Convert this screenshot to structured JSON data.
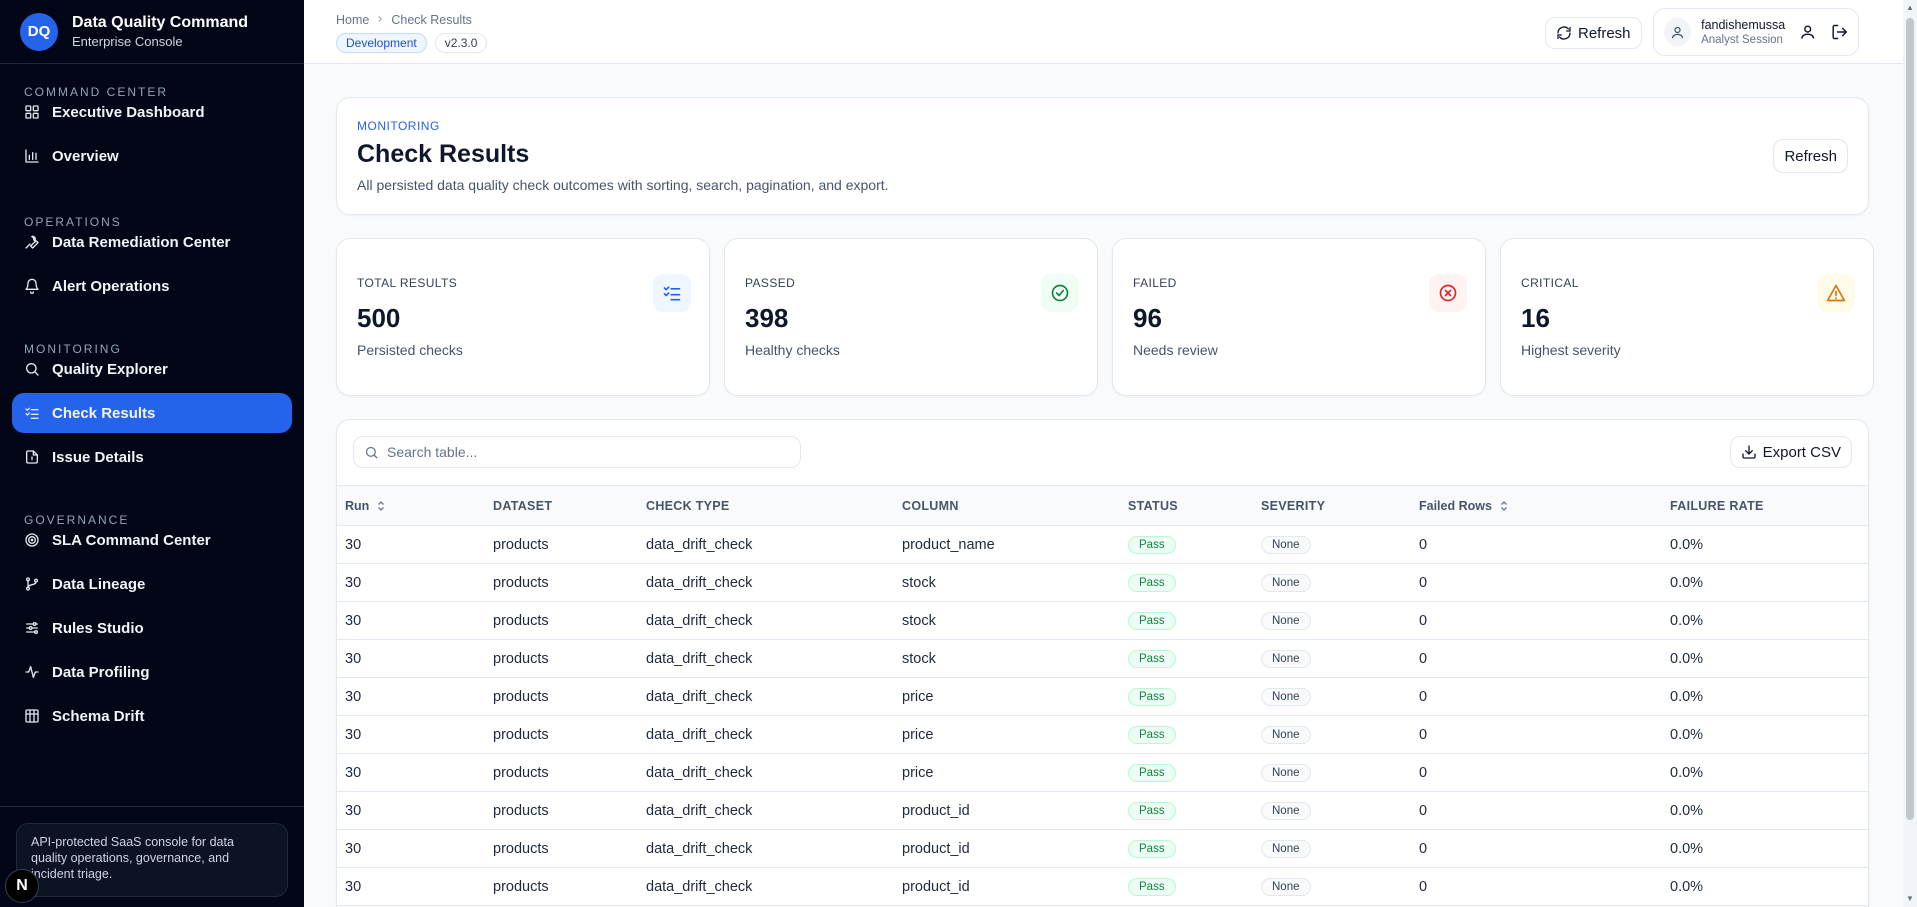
{
  "brand": {
    "logo": "DQ",
    "title": "Data Quality Command",
    "subtitle": "Enterprise Console"
  },
  "nav": {
    "sections": [
      {
        "title": "COMMAND CENTER",
        "items": [
          {
            "label": "Executive Dashboard",
            "icon": "grid-icon"
          },
          {
            "label": "Overview",
            "icon": "bar-chart-icon"
          }
        ]
      },
      {
        "title": "OPERATIONS",
        "items": [
          {
            "label": "Data Remediation Center",
            "icon": "wrench-icon"
          },
          {
            "label": "Alert Operations",
            "icon": "bell-icon"
          }
        ]
      },
      {
        "title": "MONITORING",
        "items": [
          {
            "label": "Quality Explorer",
            "icon": "search-icon"
          },
          {
            "label": "Check Results",
            "icon": "list-check-icon",
            "active": true
          },
          {
            "label": "Issue Details",
            "icon": "file-icon"
          }
        ]
      },
      {
        "title": "GOVERNANCE",
        "items": [
          {
            "label": "SLA Command Center",
            "icon": "target-icon"
          },
          {
            "label": "Data Lineage",
            "icon": "git-branch-icon"
          },
          {
            "label": "Rules Studio",
            "icon": "sliders-icon"
          },
          {
            "label": "Data Profiling",
            "icon": "activity-icon"
          },
          {
            "label": "Schema Drift",
            "icon": "table-icon"
          }
        ]
      }
    ]
  },
  "sidebar_footer": {
    "text": "API-protected SaaS console for data quality operations, governance, and incident triage.",
    "badge": "N"
  },
  "topbar": {
    "breadcrumb": [
      "Home",
      "Check Results"
    ],
    "env_tag": "Development",
    "version_tag": "v2.3.0",
    "refresh_label": "Refresh",
    "user_name": "fandishemussa",
    "user_role": "Analyst Session"
  },
  "hero": {
    "eyebrow": "MONITORING",
    "title": "Check Results",
    "description": "All persisted data quality check outcomes with sorting, search, pagination, and export.",
    "refresh_label": "Refresh"
  },
  "stats": [
    {
      "label": "TOTAL RESULTS",
      "value": "500",
      "sub": "Persisted checks",
      "icon": "list-check-icon",
      "color": "#2563eb",
      "bg": "#eff6ff"
    },
    {
      "label": "PASSED",
      "value": "398",
      "sub": "Healthy checks",
      "icon": "check-circle-icon",
      "color": "#15803d",
      "bg": "#f0fdf4"
    },
    {
      "label": "FAILED",
      "value": "96",
      "sub": "Needs review",
      "icon": "x-circle-icon",
      "color": "#dc2626",
      "bg": "#fef2f2"
    },
    {
      "label": "CRITICAL",
      "value": "16",
      "sub": "Highest severity",
      "icon": "alert-triangle-icon",
      "color": "#d97706",
      "bg": "#fffbeb"
    }
  ],
  "table": {
    "search_placeholder": "Search table...",
    "export_label": "Export CSV",
    "columns": [
      "Run",
      "DATASET",
      "CHECK TYPE",
      "COLUMN",
      "STATUS",
      "SEVERITY",
      "Failed Rows",
      "FAILURE RATE"
    ],
    "rows": [
      {
        "run": "30",
        "dataset": "products",
        "check_type": "data_drift_check",
        "column": "product_name",
        "status": "Pass",
        "severity": "None",
        "failed_rows": "0",
        "failure_rate": "0.0%"
      },
      {
        "run": "30",
        "dataset": "products",
        "check_type": "data_drift_check",
        "column": "stock",
        "status": "Pass",
        "severity": "None",
        "failed_rows": "0",
        "failure_rate": "0.0%"
      },
      {
        "run": "30",
        "dataset": "products",
        "check_type": "data_drift_check",
        "column": "stock",
        "status": "Pass",
        "severity": "None",
        "failed_rows": "0",
        "failure_rate": "0.0%"
      },
      {
        "run": "30",
        "dataset": "products",
        "check_type": "data_drift_check",
        "column": "stock",
        "status": "Pass",
        "severity": "None",
        "failed_rows": "0",
        "failure_rate": "0.0%"
      },
      {
        "run": "30",
        "dataset": "products",
        "check_type": "data_drift_check",
        "column": "price",
        "status": "Pass",
        "severity": "None",
        "failed_rows": "0",
        "failure_rate": "0.0%"
      },
      {
        "run": "30",
        "dataset": "products",
        "check_type": "data_drift_check",
        "column": "price",
        "status": "Pass",
        "severity": "None",
        "failed_rows": "0",
        "failure_rate": "0.0%"
      },
      {
        "run": "30",
        "dataset": "products",
        "check_type": "data_drift_check",
        "column": "price",
        "status": "Pass",
        "severity": "None",
        "failed_rows": "0",
        "failure_rate": "0.0%"
      },
      {
        "run": "30",
        "dataset": "products",
        "check_type": "data_drift_check",
        "column": "product_id",
        "status": "Pass",
        "severity": "None",
        "failed_rows": "0",
        "failure_rate": "0.0%"
      },
      {
        "run": "30",
        "dataset": "products",
        "check_type": "data_drift_check",
        "column": "product_id",
        "status": "Pass",
        "severity": "None",
        "failed_rows": "0",
        "failure_rate": "0.0%"
      },
      {
        "run": "30",
        "dataset": "products",
        "check_type": "data_drift_check",
        "column": "product_id",
        "status": "Pass",
        "severity": "None",
        "failed_rows": "0",
        "failure_rate": "0.0%"
      }
    ]
  }
}
